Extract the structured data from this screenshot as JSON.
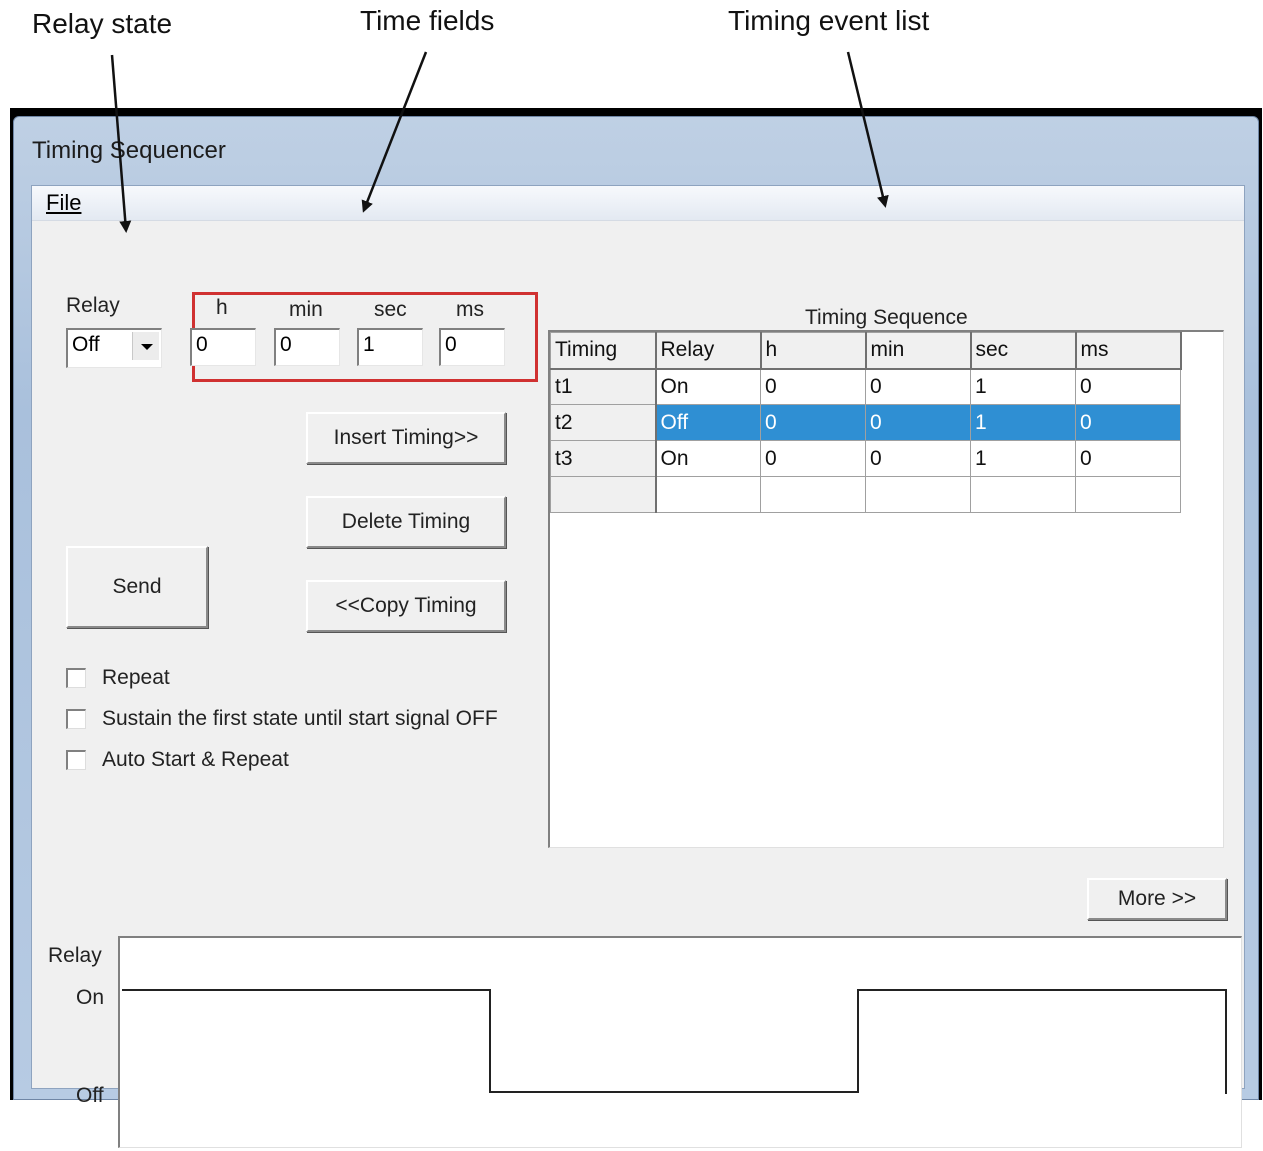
{
  "annotations": {
    "relay_state": "Relay state",
    "time_fields": "Time fields",
    "timing_event_list": "Timing event list"
  },
  "window": {
    "title": "Timing Sequencer",
    "menu_file": "File"
  },
  "relay": {
    "label": "Relay",
    "value": "Off"
  },
  "time_fields": {
    "h_label": "h",
    "min_label": "min",
    "sec_label": "sec",
    "ms_label": "ms",
    "h": "0",
    "min": "0",
    "sec": "1",
    "ms": "0"
  },
  "buttons": {
    "insert": "Insert Timing>>",
    "delete": "Delete Timing",
    "copy": "<<Copy Timing",
    "send": "Send",
    "more": "More >>"
  },
  "checkboxes": {
    "repeat": "Repeat",
    "sustain": "Sustain the first state until start signal OFF",
    "auto": "Auto Start & Repeat"
  },
  "sequence": {
    "title": "Timing Sequence",
    "columns": [
      "Timing",
      "Relay",
      "h",
      "min",
      "sec",
      "ms"
    ],
    "rows": [
      [
        "t1",
        "On",
        "0",
        "0",
        "1",
        "0"
      ],
      [
        "t2",
        "Off",
        "0",
        "0",
        "1",
        "0"
      ],
      [
        "t3",
        "On",
        "0",
        "0",
        "1",
        "0"
      ]
    ],
    "selected_row": 2
  },
  "waveform": {
    "label": "Relay",
    "on_label": "On",
    "off_label": "Off",
    "states": [
      "On",
      "Off",
      "On"
    ]
  },
  "colors": {
    "highlight": "#2f8fd3",
    "annotation_box": "#d03131"
  }
}
